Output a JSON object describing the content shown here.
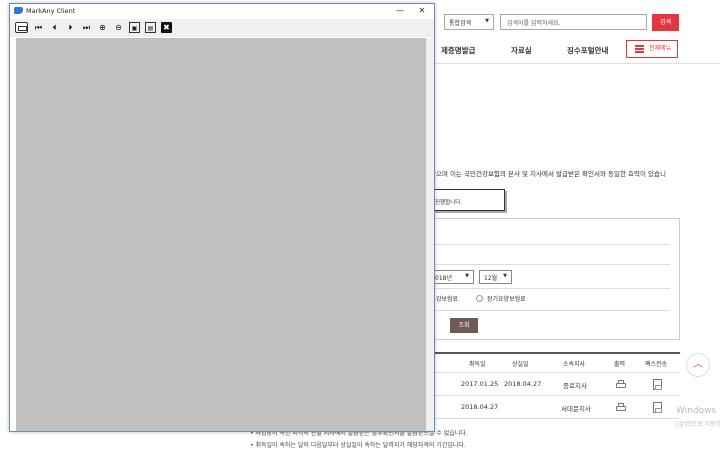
{
  "header": {
    "search_scope": "통합검색",
    "search_placeholder": "검색어를 입력하세요.",
    "search_button": "검색",
    "nav": [
      "제증명발급",
      "자료실",
      "징수포털안내"
    ],
    "all_menu": "전체메뉴"
  },
  "content": {
    "notice": "있으며 이는 국민건강보험의 본사 및 지사에서 발급받은 확인서와 동일한 효력이 있습니",
    "tooltip": "진행합니다.",
    "year_select": "018년",
    "month_select": "12월",
    "insurance_options": [
      "강보험료",
      "장기요양보험료"
    ],
    "query_button": "조회",
    "table": {
      "headers": [
        "취득일",
        "상실일",
        "소속지사",
        "출력",
        "팩스전송"
      ],
      "rows": [
        {
          "acquired": "2017.01.25",
          "lost": "2018.04.27",
          "branch": "종로지사"
        },
        {
          "acquired": "2018.04.27",
          "lost": "",
          "branch": "서대문지사"
        }
      ]
    },
    "bottom_notes": [
      "• 사업장이 속한 지역의 관할 지사에서 발급받은 납부확인서를 발급받으실 수 없습니다.",
      "• 취득일이 속하는 달의 다음달부터 상실일이 속하는 달까지가 해당자격의 기간입니다."
    ],
    "watermark": "Windows",
    "watermark_sub": "[설정]으로 이동하여"
  },
  "client_window": {
    "title": "MarkAny Client",
    "minimize": "—",
    "close": "✕",
    "toolbar_icons": [
      "print-icon",
      "first-page-icon",
      "prev-page-icon",
      "next-page-icon",
      "last-page-icon",
      "zoom-in-icon",
      "zoom-out-icon",
      "fit-page-icon",
      "save-icon",
      "close-viewer-icon"
    ],
    "colors": {
      "viewer_background": "#c0c0c0",
      "accent": "#e2373f"
    }
  }
}
